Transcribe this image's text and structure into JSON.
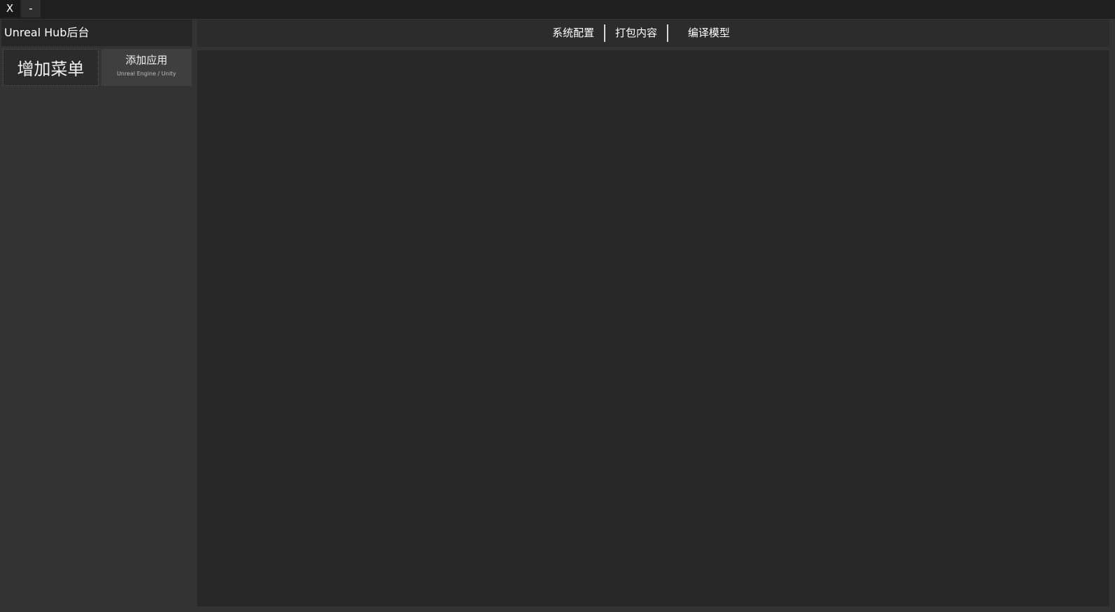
{
  "window": {
    "close_label": "X",
    "minimize_label": "-"
  },
  "sidebar": {
    "title": "Unreal Hub后台",
    "add_menu_label": "增加菜单",
    "add_app_label": "添加应用",
    "add_app_sublabel": "Unreal Engine / Unity"
  },
  "tabs": [
    {
      "label": "系统配置"
    },
    {
      "label": "打包内容"
    },
    {
      "label": "编译模型"
    }
  ],
  "colors": {
    "background": "#333333",
    "titlebar": "#1f1f1f",
    "content": "#282828",
    "text": "#ffffff"
  }
}
